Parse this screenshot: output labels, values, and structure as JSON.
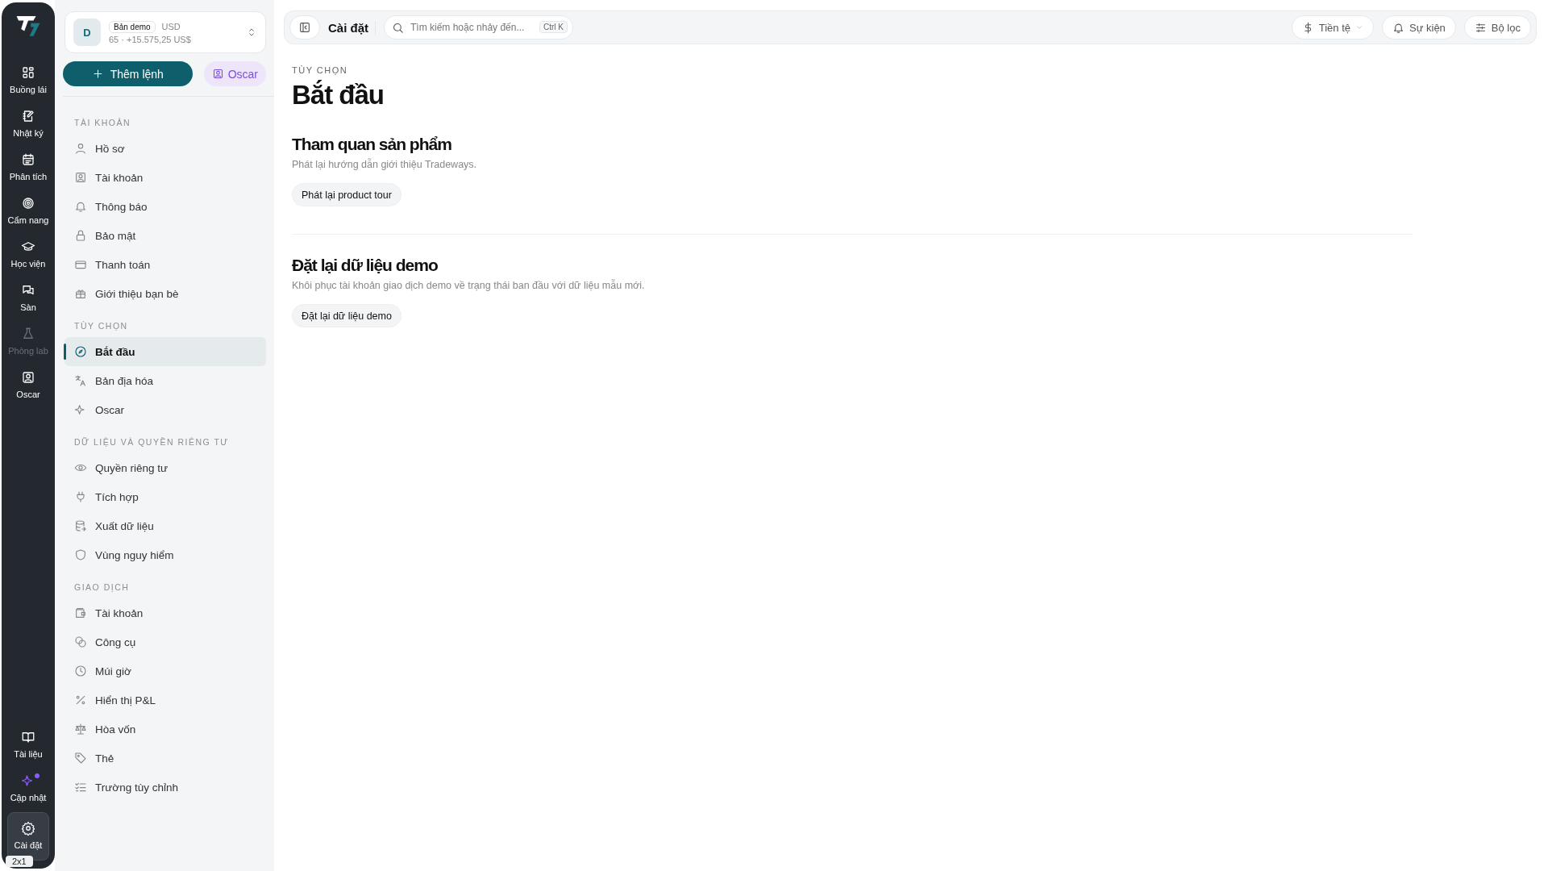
{
  "rail": {
    "items": [
      {
        "label": "Buồng lái",
        "selected": false,
        "disabled": false,
        "unread": false
      },
      {
        "label": "Nhật ký",
        "selected": false,
        "disabled": false,
        "unread": false
      },
      {
        "label": "Phân tích",
        "selected": false,
        "disabled": false,
        "unread": false
      },
      {
        "label": "Cẩm nang",
        "selected": false,
        "disabled": false,
        "unread": false
      },
      {
        "label": "Học viện",
        "selected": false,
        "disabled": false,
        "unread": false
      },
      {
        "label": "Sàn",
        "selected": false,
        "disabled": false,
        "unread": false
      },
      {
        "label": "Phòng lab",
        "selected": false,
        "disabled": true,
        "unread": false
      },
      {
        "label": "Oscar",
        "selected": false,
        "disabled": false,
        "unread": false
      }
    ],
    "bottom_items": [
      {
        "label": "Tài liệu",
        "selected": false,
        "disabled": false,
        "unread": false
      },
      {
        "label": "Cập nhật",
        "selected": false,
        "disabled": false,
        "unread": true
      },
      {
        "label": "Cài đặt",
        "selected": true,
        "disabled": false,
        "unread": false
      }
    ],
    "badge": "2x1"
  },
  "account": {
    "avatar": "D",
    "tag": "Bản demo",
    "currency": "USD",
    "summary": "65 · +15.575,25 US$"
  },
  "sidebar": {
    "add_button": "Thêm lệnh",
    "oscar_button": "Oscar",
    "sections": [
      {
        "title": "TÀI KHOẢN",
        "items": [
          {
            "label": "Hồ sơ",
            "selected": false
          },
          {
            "label": "Tài khoản",
            "selected": false
          },
          {
            "label": "Thông báo",
            "selected": false
          },
          {
            "label": "Bảo mật",
            "selected": false
          },
          {
            "label": "Thanh toán",
            "selected": false
          },
          {
            "label": "Giới thiệu bạn bè",
            "selected": false
          }
        ]
      },
      {
        "title": "TÙY CHỌN",
        "items": [
          {
            "label": "Bắt đầu",
            "selected": true
          },
          {
            "label": "Bản địa hóa",
            "selected": false
          },
          {
            "label": "Oscar",
            "selected": false
          }
        ]
      },
      {
        "title": "DỮ LIỆU VÀ QUYỀN RIÊNG TƯ",
        "items": [
          {
            "label": "Quyền riêng tư",
            "selected": false
          },
          {
            "label": "Tích hợp",
            "selected": false
          },
          {
            "label": "Xuất dữ liệu",
            "selected": false
          },
          {
            "label": "Vùng nguy hiểm",
            "selected": false
          }
        ]
      },
      {
        "title": "GIAO DỊCH",
        "items": [
          {
            "label": "Tài khoản",
            "selected": false
          },
          {
            "label": "Công cụ",
            "selected": false
          },
          {
            "label": "Múi giờ",
            "selected": false
          },
          {
            "label": "Hiển thị P&L",
            "selected": false
          },
          {
            "label": "Hòa vốn",
            "selected": false
          },
          {
            "label": "Thẻ",
            "selected": false
          },
          {
            "label": "Trường tùy chỉnh",
            "selected": false
          }
        ]
      }
    ]
  },
  "header": {
    "title": "Cài đặt",
    "search": {
      "placeholder": "Tìm kiếm hoặc nhảy đến...",
      "shortcut": "Ctrl K"
    },
    "actions": [
      {
        "label": "Tiền tệ",
        "kind": "dropdown"
      },
      {
        "label": "Sự kiện",
        "kind": "button"
      },
      {
        "label": "Bộ lọc",
        "kind": "button"
      }
    ]
  },
  "page": {
    "eyebrow": "TÙY CHỌN",
    "title": "Bắt đầu",
    "sections": [
      {
        "title": "Tham quan sản phẩm",
        "description": "Phát lại hướng dẫn giới thiệu Tradeways.",
        "button": "Phát lại product tour"
      },
      {
        "title": "Đặt lại dữ liệu demo",
        "description": "Khôi phục tài khoản giao dịch demo về trạng thái ban đầu với dữ liệu mẫu mới.",
        "button": "Đặt lại dữ liệu demo"
      }
    ]
  }
}
